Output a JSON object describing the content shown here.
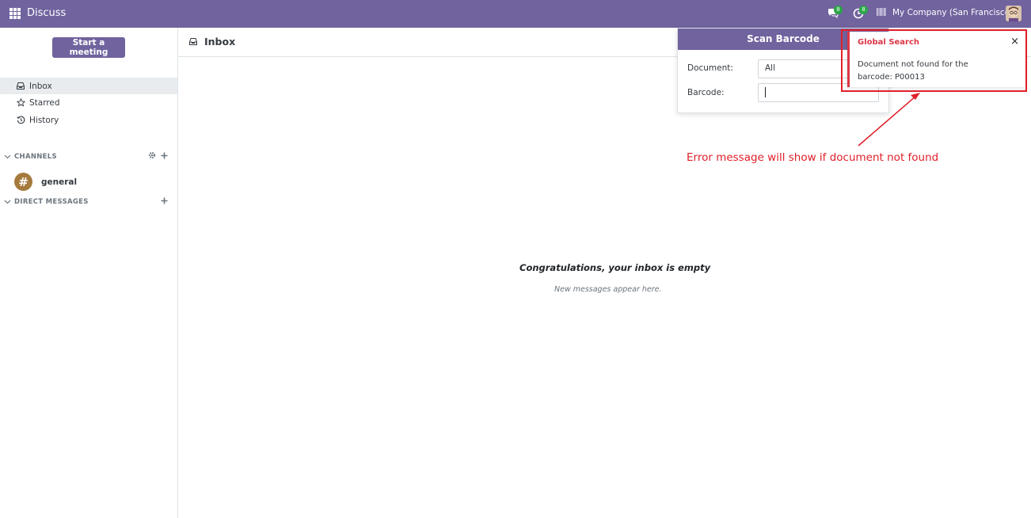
{
  "navbar": {
    "app_name": "Discuss",
    "messages_badge": "8",
    "activities_badge": "8",
    "company": "My Company (San Francisco)"
  },
  "sidebar": {
    "start_meeting": "Start a meeting",
    "items": [
      {
        "label": "Inbox",
        "icon": "inbox-icon",
        "active": true
      },
      {
        "label": "Starred",
        "icon": "star-icon"
      },
      {
        "label": "History",
        "icon": "history-icon"
      }
    ],
    "channels_label": "CHANNELS",
    "channels": [
      {
        "name": "general",
        "avatar": "#"
      }
    ],
    "direct_messages_label": "DIRECT MESSAGES"
  },
  "main": {
    "title": "Inbox",
    "empty_title": "Congratulations, your inbox is empty",
    "empty_subtitle": "New messages appear here."
  },
  "scan_barcode": {
    "title": "Scan Barcode",
    "document_label": "Document:",
    "document_value": "All",
    "barcode_label": "Barcode:",
    "barcode_value": ""
  },
  "notification": {
    "title": "Global Search",
    "message": "Document not found for the barcode: P00013",
    "close": "×"
  },
  "annotation": {
    "text": "Error message will show if document not found",
    "color": "#e0202a"
  },
  "colors": {
    "brand": "#71639e",
    "danger": "#dc3545",
    "badge": "#28a745"
  }
}
